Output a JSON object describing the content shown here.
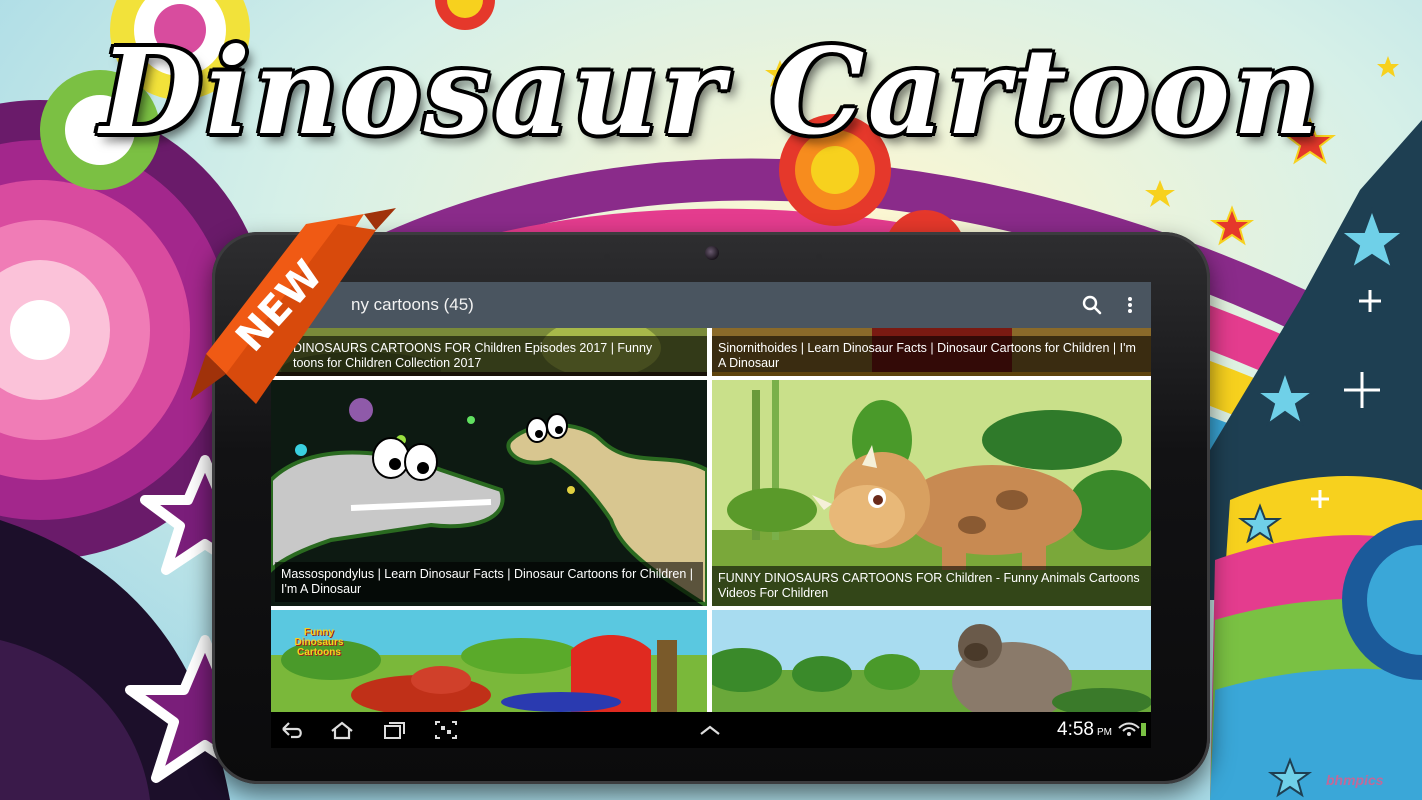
{
  "promo": {
    "title": "Dinosaur Cartoon",
    "badge": "NEW",
    "watermark": "bhmpics"
  },
  "app": {
    "title": "ny cartoons (45)",
    "actions": [
      "search-icon",
      "overflow-menu-icon"
    ]
  },
  "videos": [
    {
      "caption": "DINOSAURS CARTOONS FOR Children Episodes 2017 | Funny\ntoons for Children Collection 2017"
    },
    {
      "caption": "Sinornithoides | Learn Dinosaur Facts | Dinosaur Cartoons for Children | I'm A Dinosaur"
    },
    {
      "caption": "Massospondylus | Learn Dinosaur Facts | Dinosaur Cartoons for Children | I'm A Dinosaur"
    },
    {
      "caption": "FUNNY DINOSAURS CARTOONS FOR Children - Funny Animals Cartoons Videos For Children"
    },
    {
      "caption": "",
      "thumb_text": "Funny Dinosaurs Cartoons"
    },
    {
      "caption": ""
    }
  ],
  "status_bar": {
    "time": "4:58",
    "ampm": "PM"
  },
  "colors": {
    "action_bar": "#4a5560",
    "selected_border": "#f0a020",
    "ribbon": "#f05a14"
  }
}
